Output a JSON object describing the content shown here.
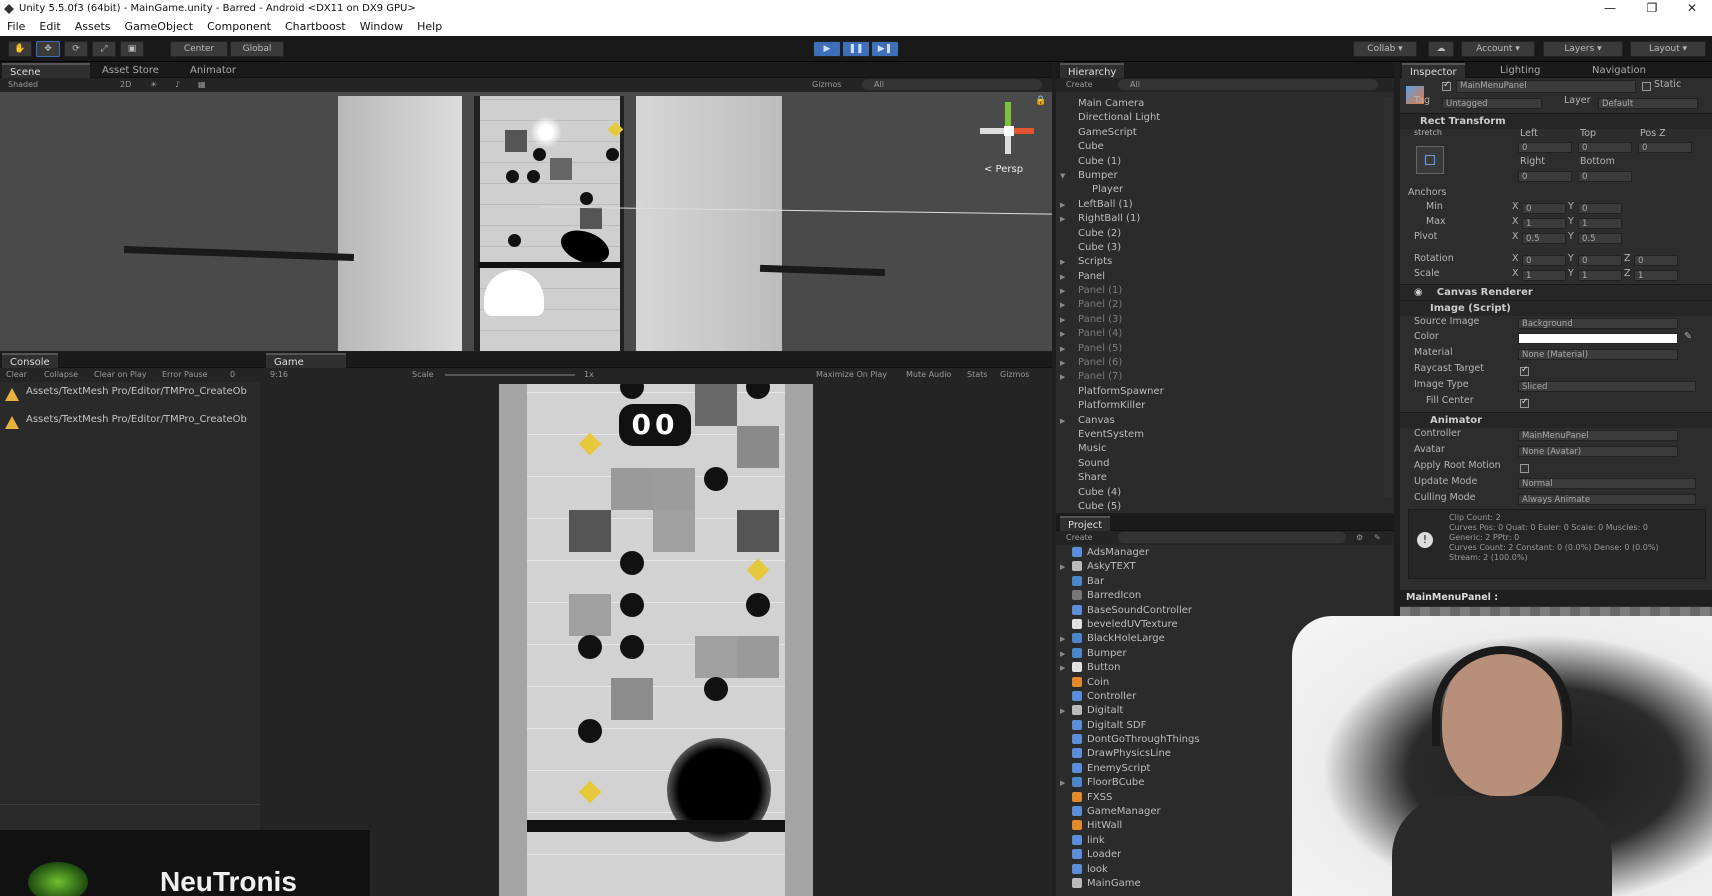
{
  "window": {
    "title": "Unity 5.5.0f3 (64bit) - MainGame.unity - Barred - Android <DX11 on DX9 GPU>",
    "min": "—",
    "max": "❐",
    "close": "✕"
  },
  "menu": [
    "File",
    "Edit",
    "Assets",
    "GameObject",
    "Component",
    "Chartboost",
    "Window",
    "Help"
  ],
  "toolbar": {
    "center": "Center",
    "global": "Global",
    "collab": "Collab",
    "account": "Account",
    "layers": "Layers",
    "layout": "Layout",
    "play": "▶",
    "pause": "❚❚",
    "step": "▶❚"
  },
  "scene": {
    "tabs": [
      "Scene",
      "Asset Store",
      "Animator"
    ],
    "shaded": "Shaded",
    "mode2d": "2D",
    "gizmos": "Gizmos",
    "search": "All",
    "persp": "< Persp"
  },
  "console": {
    "tab": "Console",
    "buttons": [
      "Clear",
      "Collapse",
      "Clear on Play",
      "Error Pause"
    ],
    "count": "0",
    "messages": [
      "Assets/TextMesh Pro/Editor/TMPro_CreateOb",
      "Assets/TextMesh Pro/Editor/TMPro_CreateOb"
    ]
  },
  "game": {
    "tab": "Game",
    "aspect": "9:16",
    "scale_label": "Scale",
    "scale_value": "1x",
    "buttons": [
      "Maximize On Play",
      "Mute Audio",
      "Stats",
      "Gizmos"
    ],
    "score": "00"
  },
  "hierarchy": {
    "tab": "Hierarchy",
    "create": "Create",
    "search": "All",
    "items": [
      {
        "label": "Main Camera",
        "arrow": "",
        "indent": 0,
        "dim": false
      },
      {
        "label": "Directional Light",
        "arrow": "",
        "indent": 0,
        "dim": false
      },
      {
        "label": "GameScript",
        "arrow": "",
        "indent": 0,
        "dim": false
      },
      {
        "label": "Cube",
        "arrow": "",
        "indent": 0,
        "dim": false
      },
      {
        "label": "Cube (1)",
        "arrow": "",
        "indent": 0,
        "dim": false
      },
      {
        "label": "Bumper",
        "arrow": "▼",
        "indent": 0,
        "dim": false
      },
      {
        "label": "Player",
        "arrow": "",
        "indent": 1,
        "dim": false
      },
      {
        "label": "LeftBall (1)",
        "arrow": "▶",
        "indent": 0,
        "dim": false
      },
      {
        "label": "RightBall (1)",
        "arrow": "▶",
        "indent": 0,
        "dim": false
      },
      {
        "label": "Cube (2)",
        "arrow": "",
        "indent": 0,
        "dim": false
      },
      {
        "label": "Cube (3)",
        "arrow": "",
        "indent": 0,
        "dim": false
      },
      {
        "label": "Scripts",
        "arrow": "▶",
        "indent": 0,
        "dim": false
      },
      {
        "label": "Panel",
        "arrow": "▶",
        "indent": 0,
        "dim": false
      },
      {
        "label": "Panel (1)",
        "arrow": "▶",
        "indent": 0,
        "dim": true
      },
      {
        "label": "Panel (2)",
        "arrow": "▶",
        "indent": 0,
        "dim": true
      },
      {
        "label": "Panel (3)",
        "arrow": "▶",
        "indent": 0,
        "dim": true
      },
      {
        "label": "Panel (4)",
        "arrow": "▶",
        "indent": 0,
        "dim": true
      },
      {
        "label": "Panel (5)",
        "arrow": "▶",
        "indent": 0,
        "dim": true
      },
      {
        "label": "Panel (6)",
        "arrow": "▶",
        "indent": 0,
        "dim": true
      },
      {
        "label": "Panel (7)",
        "arrow": "▶",
        "indent": 0,
        "dim": true
      },
      {
        "label": "PlatformSpawner",
        "arrow": "",
        "indent": 0,
        "dim": false
      },
      {
        "label": "PlatformKiller",
        "arrow": "",
        "indent": 0,
        "dim": false
      },
      {
        "label": "Canvas",
        "arrow": "▶",
        "indent": 0,
        "dim": false
      },
      {
        "label": "EventSystem",
        "arrow": "",
        "indent": 0,
        "dim": false
      },
      {
        "label": "Music",
        "arrow": "",
        "indent": 0,
        "dim": false
      },
      {
        "label": "Sound",
        "arrow": "",
        "indent": 0,
        "dim": false
      },
      {
        "label": "Share",
        "arrow": "",
        "indent": 0,
        "dim": false
      },
      {
        "label": "Cube (4)",
        "arrow": "",
        "indent": 0,
        "dim": false
      },
      {
        "label": "Cube (5)",
        "arrow": "",
        "indent": 0,
        "dim": false
      }
    ]
  },
  "project": {
    "tab": "Project",
    "create": "Create",
    "items": [
      {
        "label": "AdsManager",
        "arrow": "",
        "icon": "script-icon",
        "color": "#5b8ed6"
      },
      {
        "label": "AskyTEXT",
        "arrow": "▶",
        "icon": "font-icon",
        "color": "#bbbbbb"
      },
      {
        "label": "Bar",
        "arrow": "",
        "icon": "prefab-icon",
        "color": "#4a86c8"
      },
      {
        "label": "BarredIcon",
        "arrow": "",
        "icon": "texture-icon",
        "color": "#777777"
      },
      {
        "label": "BaseSoundController",
        "arrow": "",
        "icon": "script-icon",
        "color": "#5b8ed6"
      },
      {
        "label": "beveledUVTexture",
        "arrow": "",
        "icon": "texture-icon",
        "color": "#e0e0e0"
      },
      {
        "label": "BlackHoleLarge",
        "arrow": "▶",
        "icon": "prefab-icon",
        "color": "#4a86c8"
      },
      {
        "label": "Bumper",
        "arrow": "▶",
        "icon": "prefab-icon",
        "color": "#4a86c8"
      },
      {
        "label": "Button",
        "arrow": "▶",
        "icon": "texture-icon",
        "color": "#e0e0e0"
      },
      {
        "label": "Coin",
        "arrow": "",
        "icon": "anim-icon",
        "color": "#e08a2c"
      },
      {
        "label": "Controller",
        "arrow": "",
        "icon": "script-icon",
        "color": "#5b8ed6"
      },
      {
        "label": "Digitalt",
        "arrow": "▶",
        "icon": "font-icon",
        "color": "#bbbbbb"
      },
      {
        "label": "Digitalt SDF",
        "arrow": "",
        "icon": "script-icon",
        "color": "#5b8ed6"
      },
      {
        "label": "DontGoThroughThings",
        "arrow": "",
        "icon": "script-icon",
        "color": "#5b8ed6"
      },
      {
        "label": "DrawPhysicsLine",
        "arrow": "",
        "icon": "script-icon",
        "color": "#5b8ed6"
      },
      {
        "label": "EnemyScript",
        "arrow": "",
        "icon": "script-icon",
        "color": "#5b8ed6"
      },
      {
        "label": "FloorBCube",
        "arrow": "▶",
        "icon": "prefab-icon",
        "color": "#4a86c8"
      },
      {
        "label": "FXSS",
        "arrow": "",
        "icon": "anim-icon",
        "color": "#e08a2c"
      },
      {
        "label": "GameManager",
        "arrow": "",
        "icon": "script-icon",
        "color": "#5b8ed6"
      },
      {
        "label": "HitWall",
        "arrow": "",
        "icon": "anim-icon",
        "color": "#e08a2c"
      },
      {
        "label": "link",
        "arrow": "",
        "icon": "script-icon",
        "color": "#5b8ed6"
      },
      {
        "label": "Loader",
        "arrow": "",
        "icon": "script-icon",
        "color": "#5b8ed6"
      },
      {
        "label": "look",
        "arrow": "",
        "icon": "script-icon",
        "color": "#5b8ed6"
      },
      {
        "label": "MainGame",
        "arrow": "",
        "icon": "scene-icon",
        "color": "#bbbbbb"
      }
    ]
  },
  "inspector": {
    "tabs": [
      "Inspector",
      "Lighting",
      "Navigation"
    ],
    "object_name": "MainMenuPanel",
    "static": "Static",
    "tag_label": "Tag",
    "tag": "Untagged",
    "layer_label": "Layer",
    "layer": "Default",
    "rect": {
      "title": "Rect Transform",
      "stretch": "stretch",
      "left": "Left",
      "top": "Top",
      "posz": "Pos Z",
      "left_v": "0",
      "top_v": "0",
      "posz_v": "0",
      "right": "Right",
      "bottom": "Bottom",
      "right_v": "0",
      "bottom_v": "0",
      "anchors": "Anchors",
      "min": "Min",
      "max": "Max",
      "pivot": "Pivot",
      "rotation": "Rotation",
      "scale": "Scale",
      "x": "X",
      "y": "Y",
      "z": "Z",
      "min_x": "0",
      "min_y": "0",
      "max_x": "1",
      "max_y": "1",
      "pivot_x": "0.5",
      "pivot_y": "0.5",
      "rot_x": "0",
      "rot_y": "0",
      "rot_z": "0",
      "sc_x": "1",
      "sc_y": "1",
      "sc_z": "1"
    },
    "canvas_renderer": "Canvas Renderer",
    "image": {
      "title": "Image (Script)",
      "source_label": "Source Image",
      "source": "Background",
      "color_label": "Color",
      "material_label": "Material",
      "material": "None (Material)",
      "raycast_label": "Raycast Target",
      "type_label": "Image Type",
      "type": "Sliced",
      "fill_label": "Fill Center"
    },
    "animator": {
      "title": "Animator",
      "controller_label": "Controller",
      "controller": "MainMenuPanel",
      "avatar_label": "Avatar",
      "avatar": "None (Avatar)",
      "root_label": "Apply Root Motion",
      "update_label": "Update Mode",
      "update": "Normal",
      "culling_label": "Culling Mode",
      "culling": "Always Animate",
      "info": [
        "Clip Count: 2",
        "Curves Pos: 0 Quat: 0 Euler: 0 Scale: 0 Muscles: 0",
        "Generic: 2 PPtr: 0",
        "Curves Count: 2 Constant: 0 (0.0%) Dense: 0 (0.0%)",
        "Stream: 2 (100.0%)"
      ]
    },
    "footer": "MainMenuPanel :"
  },
  "overlay": {
    "brand": "NeuTronis"
  }
}
